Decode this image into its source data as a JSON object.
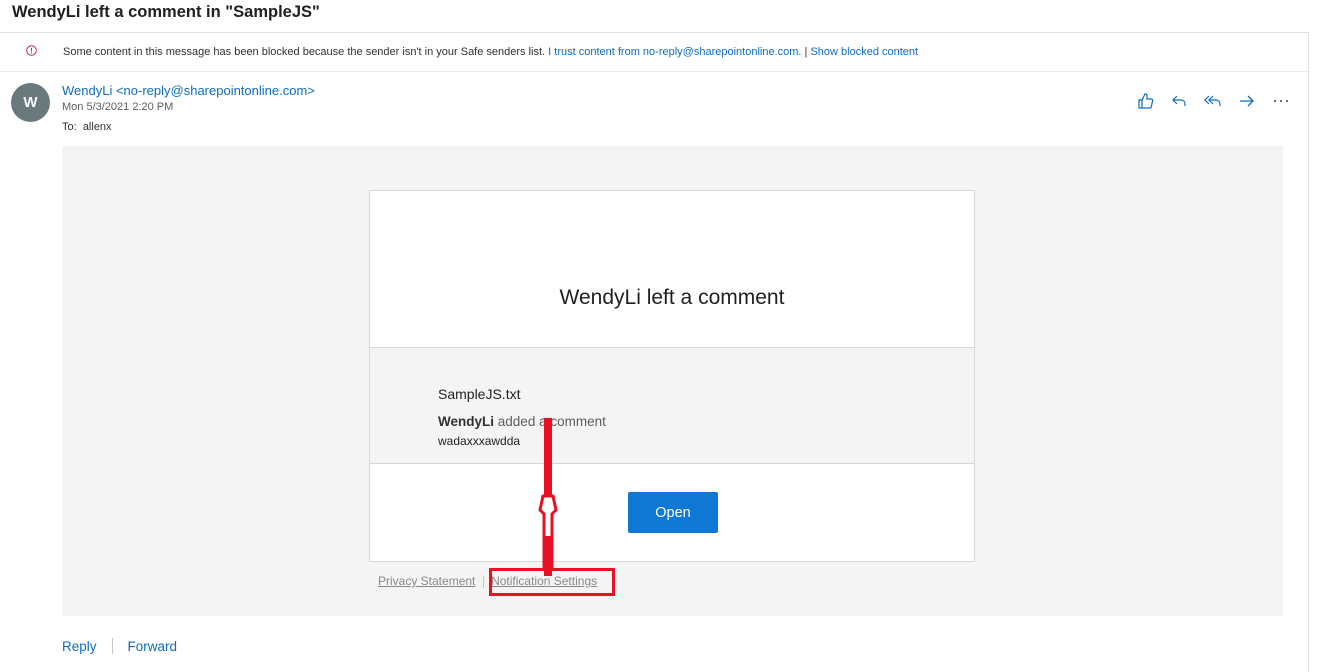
{
  "email": {
    "subject": "WendyLi left a comment in \"SampleJS\"",
    "info_bar": {
      "message": "Some content in this message has been blocked because the sender isn't in your Safe senders list.",
      "trust_link": "I trust content from no-reply@sharepointonline.com.",
      "separator": "|",
      "show_link": "Show blocked content"
    },
    "sender": {
      "initial": "W",
      "display": "WendyLi <no-reply@sharepointonline.com>",
      "date": "Mon 5/3/2021 2:20 PM",
      "to_label": "To:",
      "to_value": "allenx"
    },
    "actions": [
      "like-icon",
      "reply-icon",
      "reply-all-icon",
      "forward-icon",
      "more-icon"
    ],
    "card": {
      "title": "WendyLi left a comment",
      "filename": "SampleJS.txt",
      "commenter": "WendyLi",
      "comment_action": "added a comment",
      "comment_text": "wadaxxxawdda",
      "open_button": "Open"
    },
    "footer": {
      "privacy": "Privacy Statement",
      "notification": "Notification Settings"
    },
    "bottom_actions": {
      "reply": "Reply",
      "forward": "Forward"
    },
    "colors": {
      "accent": "#0f6cbd",
      "button": "#0f78d4",
      "annotation": "#e81123",
      "avatar": "#69797e"
    }
  }
}
